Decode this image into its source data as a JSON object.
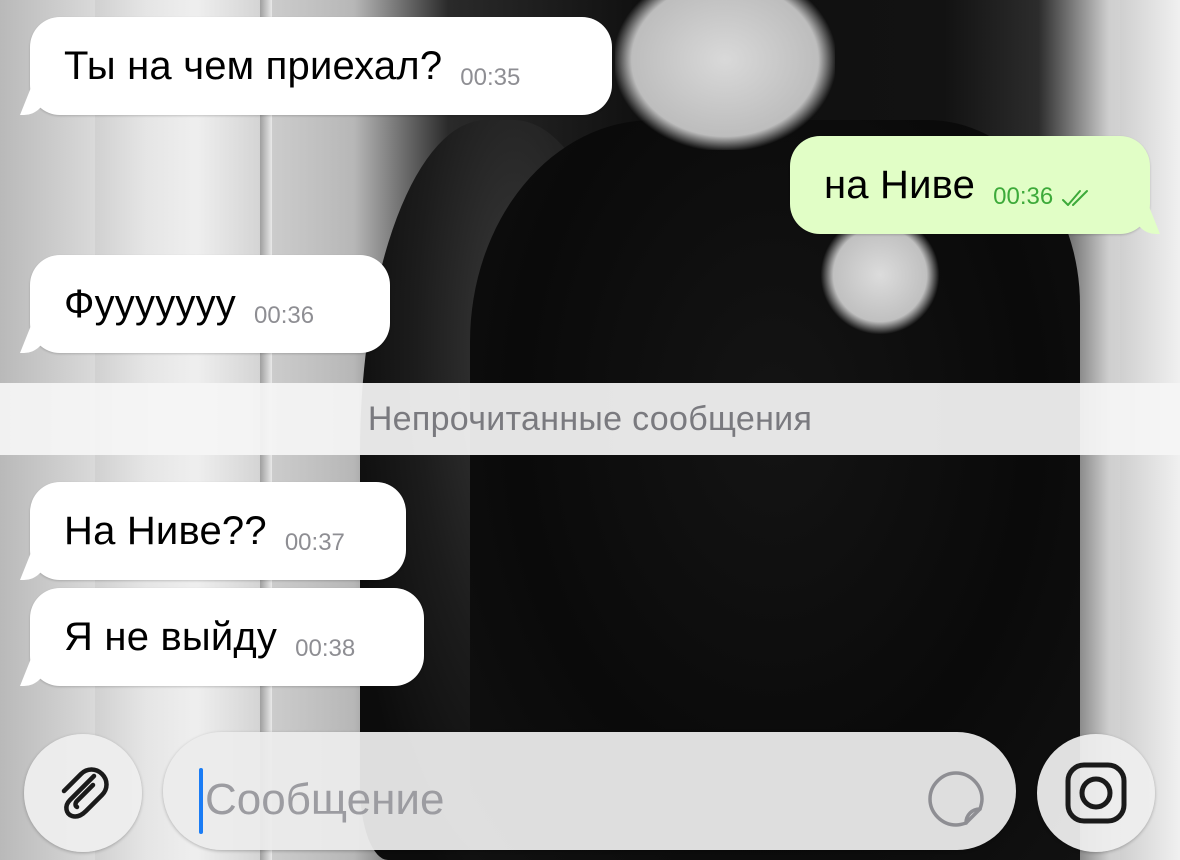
{
  "messages": [
    {
      "text": "Ты на чем приехал?",
      "time": "00:35",
      "direction": "incoming"
    },
    {
      "text": "на Ниве",
      "time": "00:36",
      "direction": "outgoing",
      "status": "read"
    },
    {
      "text": "Фууууууу",
      "time": "00:36",
      "direction": "incoming"
    },
    {
      "text": "На Ниве??",
      "time": "00:37",
      "direction": "incoming"
    },
    {
      "text": "Я не выйду",
      "time": "00:38",
      "direction": "incoming"
    }
  ],
  "unread_divider": {
    "label": "Непрочитанные сообщения"
  },
  "composer": {
    "placeholder": "Сообщение",
    "value": "",
    "attach_icon": "paperclip-icon",
    "sticker_icon": "sticker-icon",
    "camera_icon": "camera-icon"
  },
  "colors": {
    "incoming_bubble": "#ffffff",
    "outgoing_bubble": "#e1fec6",
    "outgoing_time": "#3daa3a",
    "caret": "#1a7cf5"
  }
}
